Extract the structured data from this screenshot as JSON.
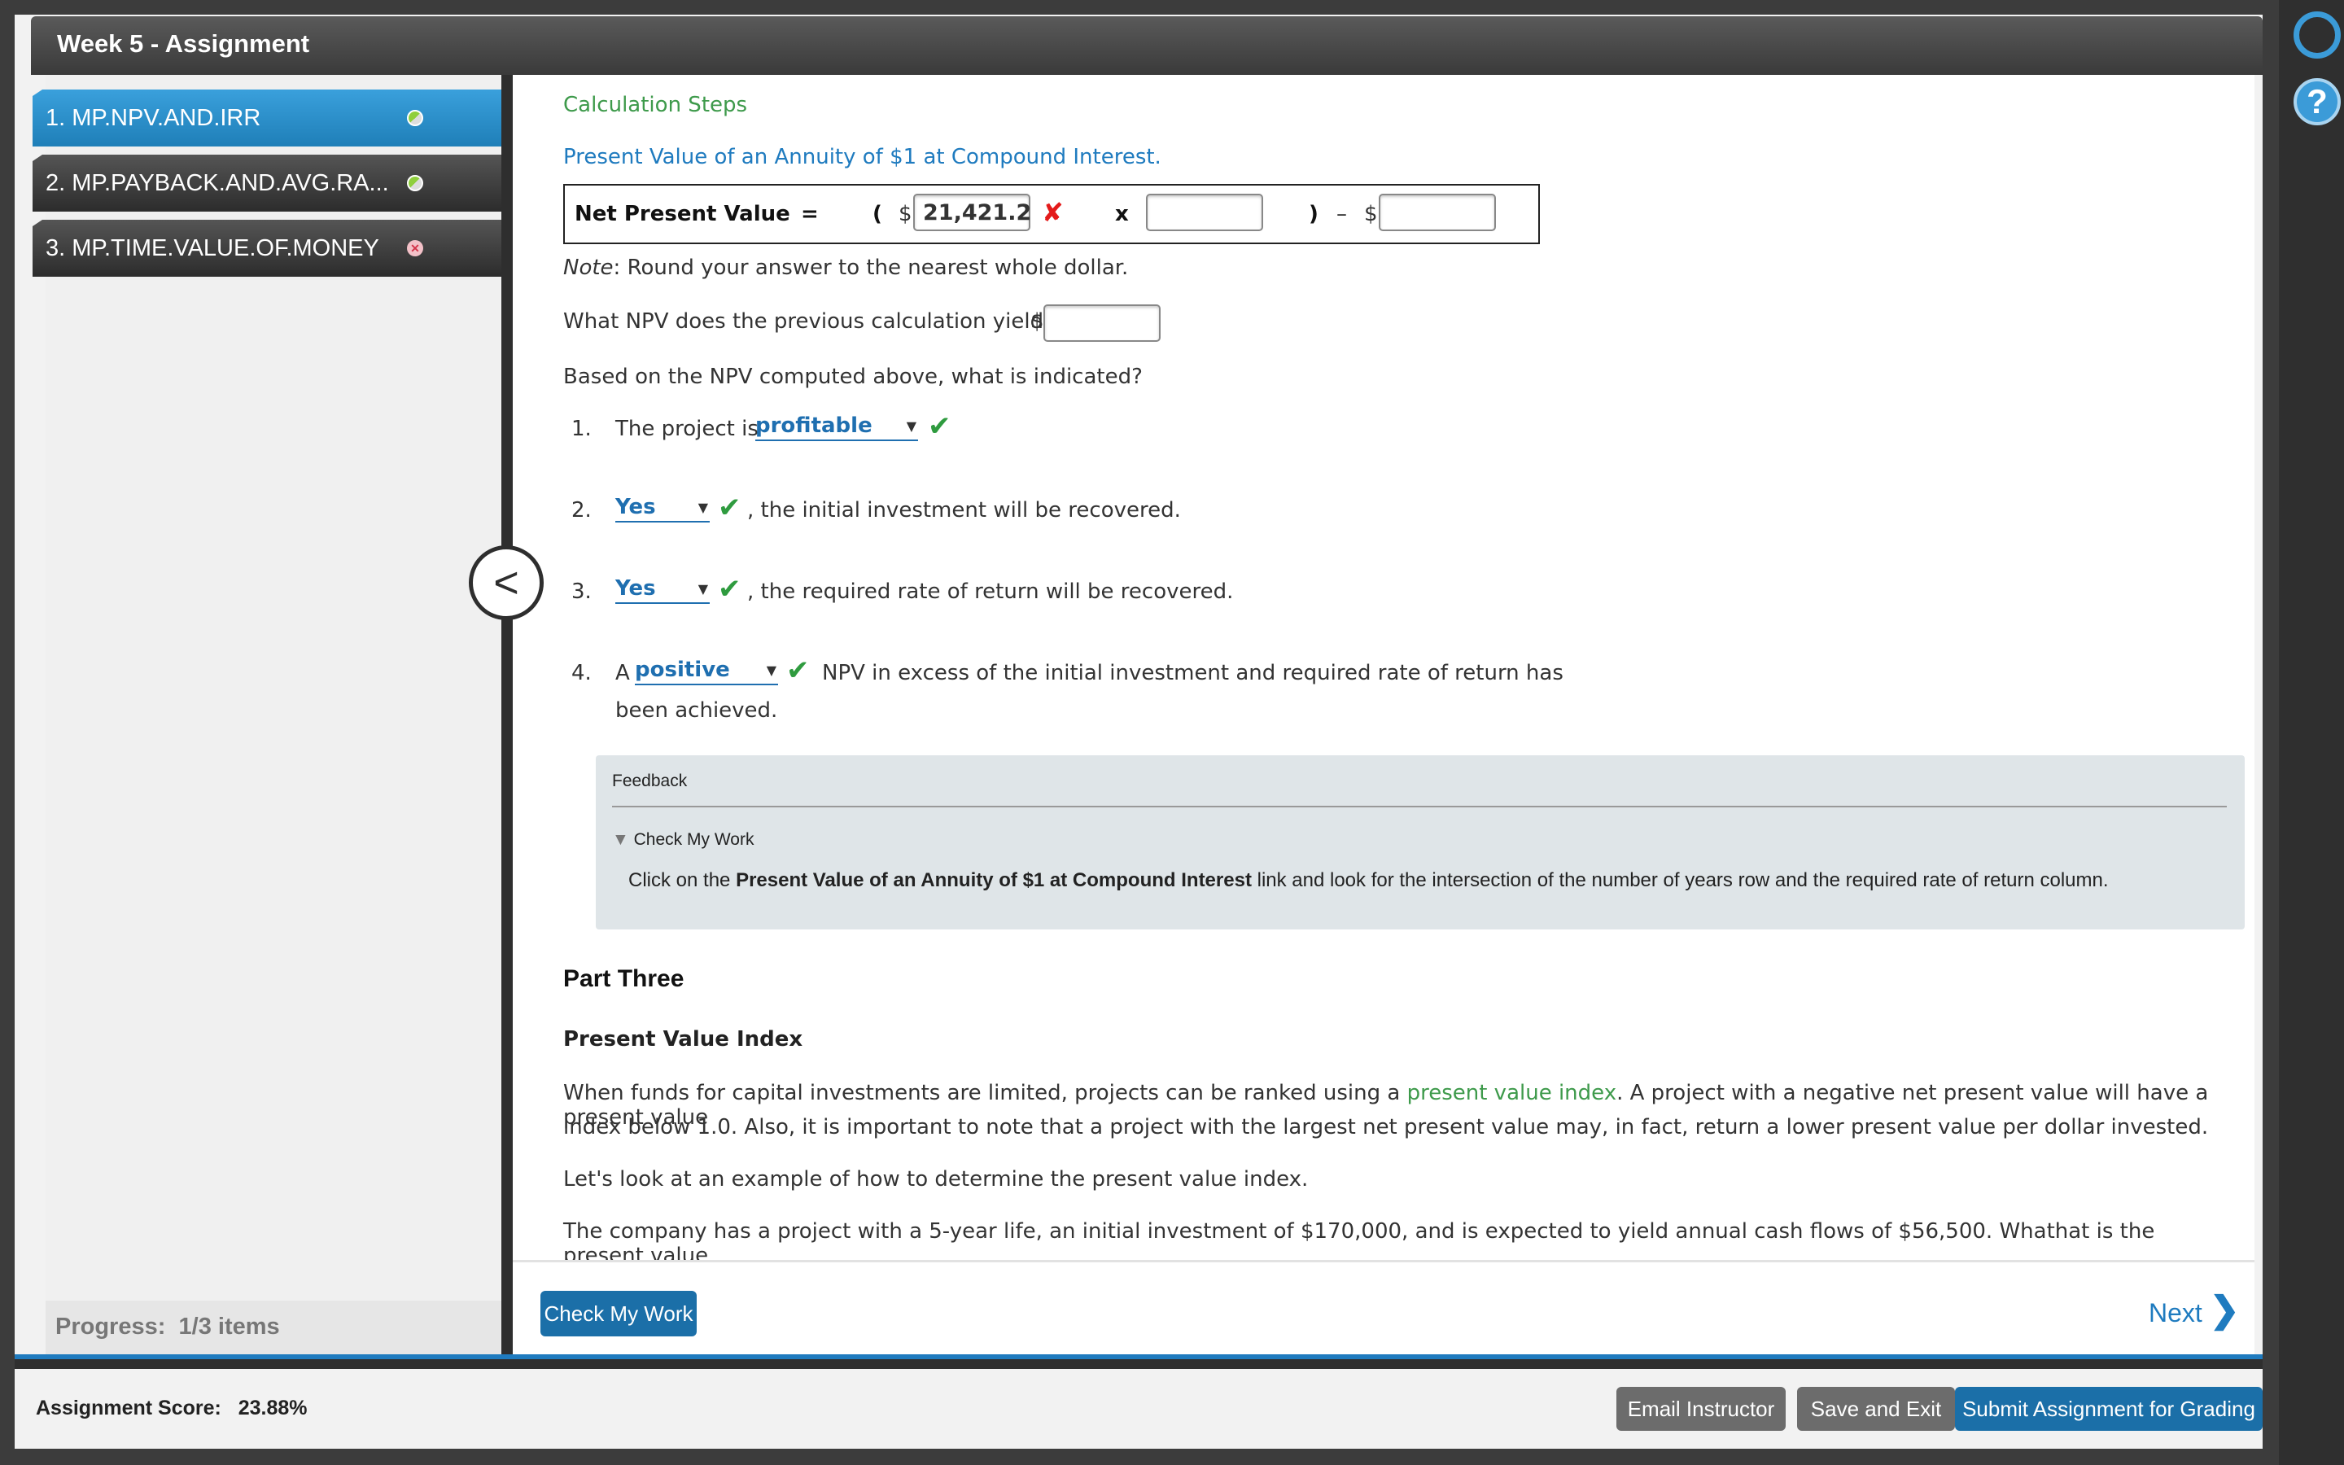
{
  "window": {
    "title": "Week 5 - Assignment"
  },
  "sidebar": {
    "items": [
      {
        "label": "1. MP.NPV.AND.IRR",
        "status": "partial"
      },
      {
        "label": "2. MP.PAYBACK.AND.AVG.RA...",
        "status": "partial"
      },
      {
        "label": "3. MP.TIME.VALUE.OF.MONEY",
        "status": "incorrect"
      }
    ],
    "progress_label": "Progress:",
    "progress_value": "1/3 items"
  },
  "content": {
    "calc_steps": "Calculation Steps",
    "pv_link": "Present Value of an Annuity of $1 at Compound Interest.",
    "equation": {
      "label": "Net Present Value",
      "equals": "=",
      "open_paren": "(",
      "dollar1": "$",
      "value1": "21,421.2",
      "times": "x",
      "close_paren": ")",
      "minus": "–",
      "dollar2": "$"
    },
    "note_label": "Note",
    "note_text": ": Round your answer to the nearest whole dollar.",
    "npv_question": "What NPV does the previous calculation yield?",
    "npv_dollar": "$",
    "indicated_question": "Based on the NPV computed above, what is indicated?",
    "items": [
      {
        "num": "1.",
        "before": "The project is",
        "select": "profitable",
        "after": ""
      },
      {
        "num": "2.",
        "before": "",
        "select": "Yes",
        "after": ", the initial investment will be recovered."
      },
      {
        "num": "3.",
        "before": "",
        "select": "Yes",
        "after": ", the required rate of return will be recovered."
      },
      {
        "num": "4.",
        "before": "A",
        "select": "positive",
        "after": "NPV in excess of the initial investment and required rate of return has",
        "after2": "been achieved."
      }
    ],
    "feedback": {
      "title": "Feedback",
      "toggle": "Check My Work",
      "text_pre": "Click on the ",
      "text_bold": "Present Value of an Annuity of $1 at Compound Interest",
      "text_post": " link and look for the intersection of the number of years row and the required rate of return column."
    },
    "part_three": "Part Three",
    "pvi_heading": "Present Value Index",
    "para1_pre": "When funds for capital investments are limited, projects can be ranked using a ",
    "para1_link": "present value index",
    "para1_post": ". A project with a negative net present value will have a present value",
    "para1_line2": "index below 1.0. Also, it is important to note that a project with the largest net present value may, in fact, return a lower present value per dollar invested.",
    "para2": "Let's look at an example of how to determine the present value index.",
    "para3": "The company has a project with a 5-year life, an initial investment of $170,000, and is expected to yield annual cash flows of $56,500. Whathat is the present value"
  },
  "bottom": {
    "check_work": "Check My Work",
    "next": "Next"
  },
  "footer": {
    "score_label": "Assignment Score:",
    "score_value": "23.88%",
    "email": "Email Instructor",
    "save_exit": "Save and Exit",
    "submit": "Submit Assignment for Grading"
  },
  "colors": {
    "accent": "#1f7bbf",
    "correct": "#2f9b3f",
    "incorrect": "#e41b1b"
  },
  "icons": [
    "headset-icon",
    "help-icon",
    "chevron-left-icon",
    "chevron-right-icon",
    "check-icon",
    "x-icon",
    "caret-down-icon",
    "triangle-down-icon"
  ]
}
